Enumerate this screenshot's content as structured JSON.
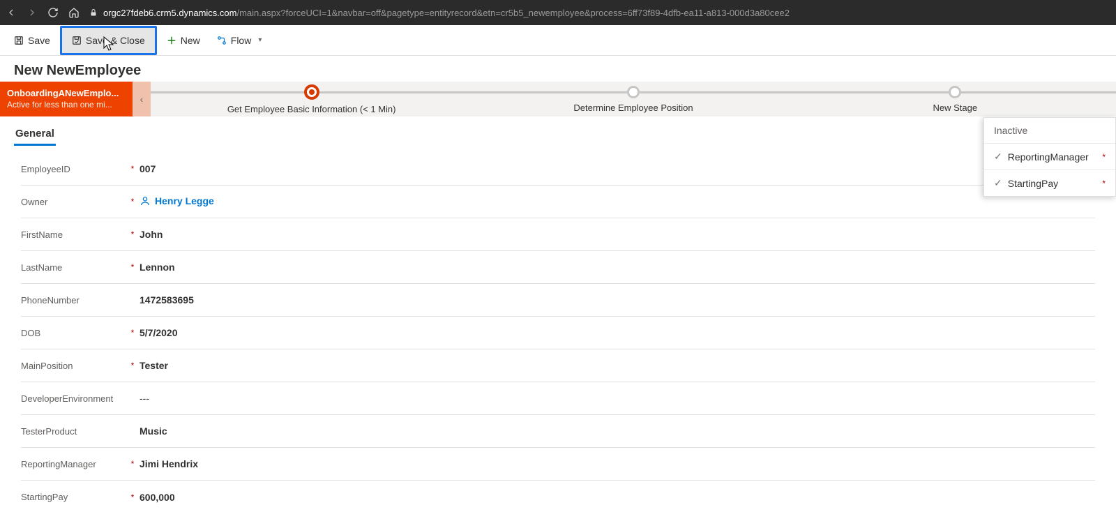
{
  "browser": {
    "host": "orgc27fdeb6.crm5.dynamics.com",
    "path": "/main.aspx?forceUCI=1&navbar=off&pagetype=entityrecord&etn=cr5b5_newemployee&process=6ff73f89-4dfb-ea11-a813-000d3a80cee2"
  },
  "commands": {
    "save": "Save",
    "save_close": "Save & Close",
    "new": "New",
    "flow": "Flow"
  },
  "page": {
    "title": "New NewEmployee"
  },
  "bpf": {
    "name": "OnboardingANewEmplo...",
    "status": "Active for less than one mi...",
    "stages": [
      {
        "label": "Get Employee Basic Information  (< 1 Min)",
        "active": true
      },
      {
        "label": "Determine Employee Position",
        "active": false
      },
      {
        "label": "New Stage",
        "active": false
      }
    ]
  },
  "tabs": {
    "general": "General"
  },
  "fields": [
    {
      "label": "EmployeeID",
      "required": true,
      "value": "007",
      "type": "text"
    },
    {
      "label": "Owner",
      "required": true,
      "value": "Henry Legge",
      "type": "owner"
    },
    {
      "label": "FirstName",
      "required": true,
      "value": "John",
      "type": "text"
    },
    {
      "label": "LastName",
      "required": true,
      "value": "Lennon",
      "type": "text"
    },
    {
      "label": "PhoneNumber",
      "required": false,
      "value": "1472583695",
      "type": "text"
    },
    {
      "label": "DOB",
      "required": true,
      "value": "5/7/2020",
      "type": "text"
    },
    {
      "label": "MainPosition",
      "required": true,
      "value": "Tester",
      "type": "text"
    },
    {
      "label": "DeveloperEnvironment",
      "required": false,
      "value": "---",
      "type": "text"
    },
    {
      "label": "TesterProduct",
      "required": false,
      "value": "Music",
      "type": "text"
    },
    {
      "label": "ReportingManager",
      "required": true,
      "value": "Jimi Hendrix",
      "type": "text"
    },
    {
      "label": "StartingPay",
      "required": true,
      "value": "600,000",
      "type": "text"
    }
  ],
  "flyout": {
    "title": "Inactive",
    "rows": [
      {
        "label": "ReportingManager",
        "required": true
      },
      {
        "label": "StartingPay",
        "required": true
      }
    ]
  }
}
